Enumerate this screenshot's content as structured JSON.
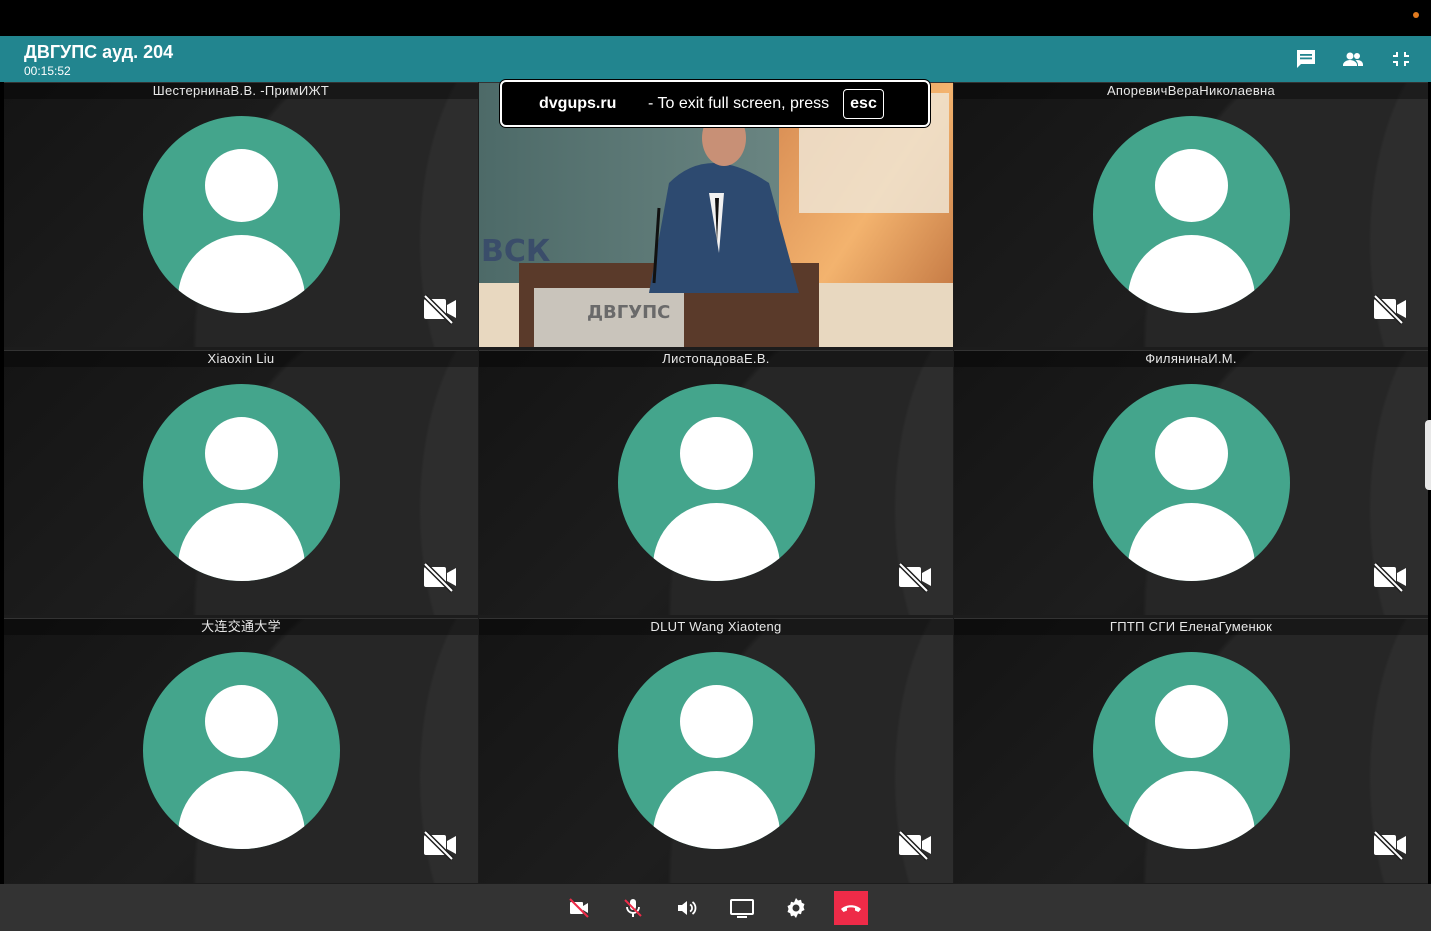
{
  "header": {
    "title": "ДВГУПС ауд. 204",
    "timer": "00:15:52",
    "icons": [
      "chat-icon",
      "participants-icon",
      "exit-fullscreen-icon"
    ]
  },
  "fullscreen_toast": {
    "site": "dvgups.ru",
    "message": "-  To exit full screen, press",
    "key": "esc"
  },
  "participants": [
    {
      "name": "ШестернинаВ.В. -ПримИЖТ",
      "camera": "off"
    },
    {
      "name": "",
      "camera": "on",
      "video_text_1": "ВСК",
      "video_text_2": "ДВГУПС"
    },
    {
      "name": "АпоревичВераНиколаевна",
      "camera": "off"
    },
    {
      "name": "Xiaoxin Liu",
      "camera": "off"
    },
    {
      "name": "ЛистопадоваЕ.В.",
      "camera": "off"
    },
    {
      "name": "ФилянинаИ.М.",
      "camera": "off"
    },
    {
      "name": "大连交通大学",
      "camera": "off"
    },
    {
      "name": "DLUT Wang Xiaoteng",
      "camera": "off"
    },
    {
      "name": "ГПТП СГИ ЕленаГуменюк",
      "camera": "off"
    }
  ],
  "toolbar": {
    "buttons": [
      "camera-off-icon",
      "mic-off-icon",
      "volume-icon",
      "screen-share-icon",
      "settings-icon",
      "hang-up-icon"
    ]
  },
  "colors": {
    "header": "#22858f",
    "avatar": "#44a58c",
    "hangup": "#ee2b48",
    "toolbar": "#333333"
  }
}
